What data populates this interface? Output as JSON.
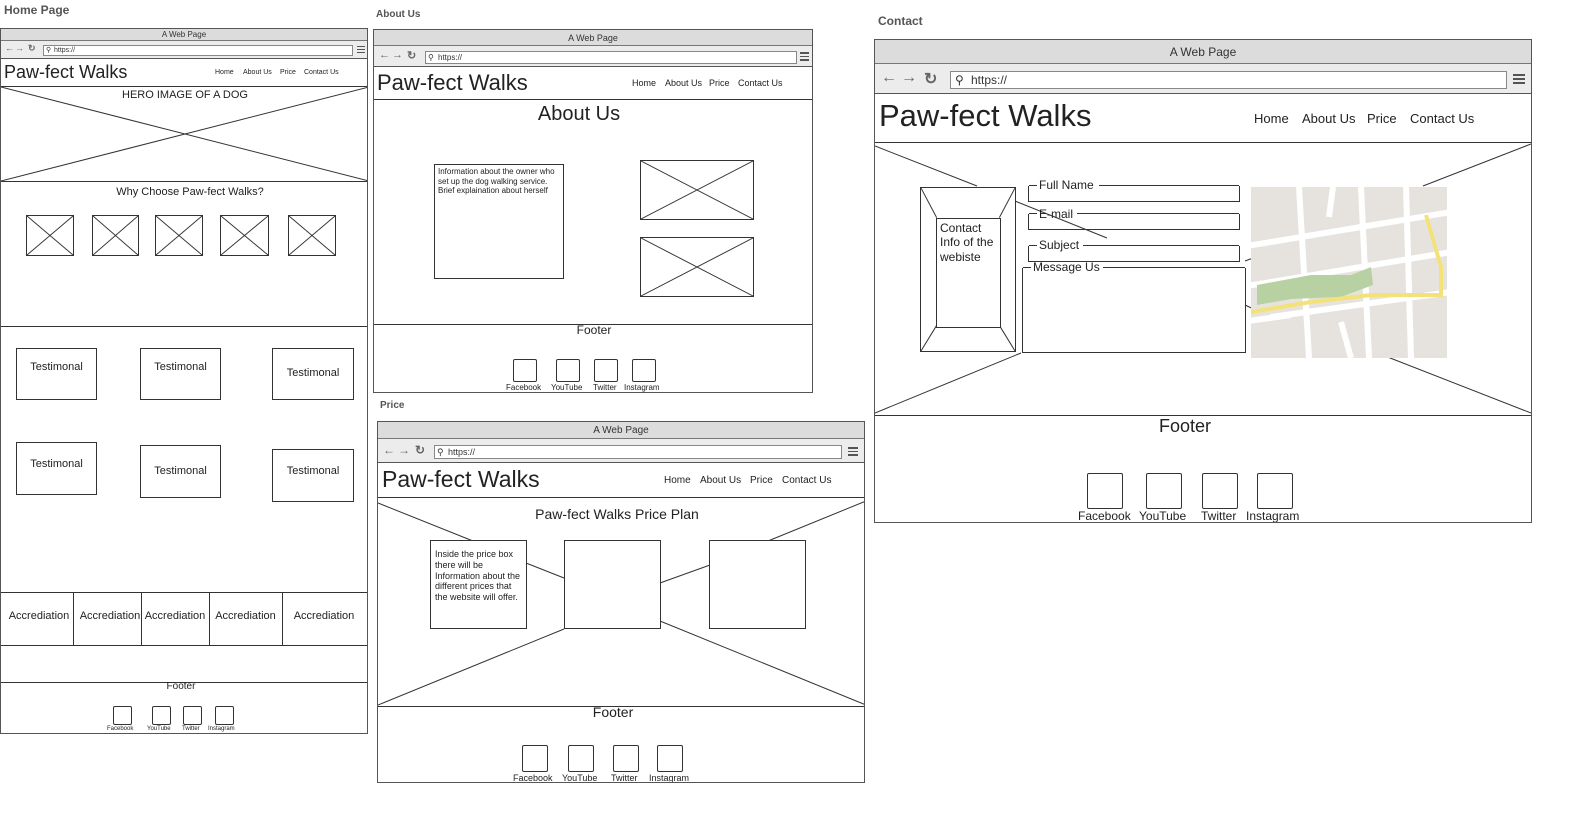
{
  "captions": {
    "home": "Home Page",
    "about": "About Us",
    "price": "Price",
    "contact": "Contact"
  },
  "browser": {
    "title": "A Web Page",
    "url": "https://"
  },
  "site": {
    "brand": "Paw-fect Walks",
    "nav": [
      "Home",
      "About Us",
      "Price",
      "Contact Us"
    ]
  },
  "home": {
    "hero": "HERO IMAGE OF A DOG",
    "why": "Why Choose Paw-fect Walks?",
    "testimonials": [
      "Testimonal",
      "Testimonal",
      "Testimonal",
      "Testimonal",
      "Testimonal",
      "Testimonal"
    ],
    "accreditations": [
      "Accrediation",
      "Accrediation",
      "Accrediation",
      "Accrediation",
      "Accrediation"
    ],
    "footer": "Footer",
    "social": [
      "Facebook",
      "YouTube",
      "Twitter",
      "Instagram"
    ]
  },
  "about": {
    "heading": "About Us",
    "owner_info": "Information about the owner who set up the dog walking service. Brief explaination about herself",
    "footer": "Footer",
    "social": [
      "Facebook",
      "YouTube",
      "Twitter",
      "Instagram"
    ]
  },
  "price": {
    "heading": "Paw-fect Walks Price Plan",
    "price_info": "Inside the price box there will be Information about the different prices that the website will offer.",
    "footer": "Footer",
    "social": [
      "Facebook",
      "YouTube",
      "Twitter",
      "Instagram"
    ]
  },
  "contact": {
    "info": "Contact Info of the webiste",
    "fields": {
      "full_name": "Full Name",
      "email": "E-mail",
      "subject": "Subject",
      "message": "Message Us"
    },
    "footer": "Footer",
    "social": [
      "Facebook",
      "YouTube",
      "Twitter",
      "Instagram"
    ]
  }
}
